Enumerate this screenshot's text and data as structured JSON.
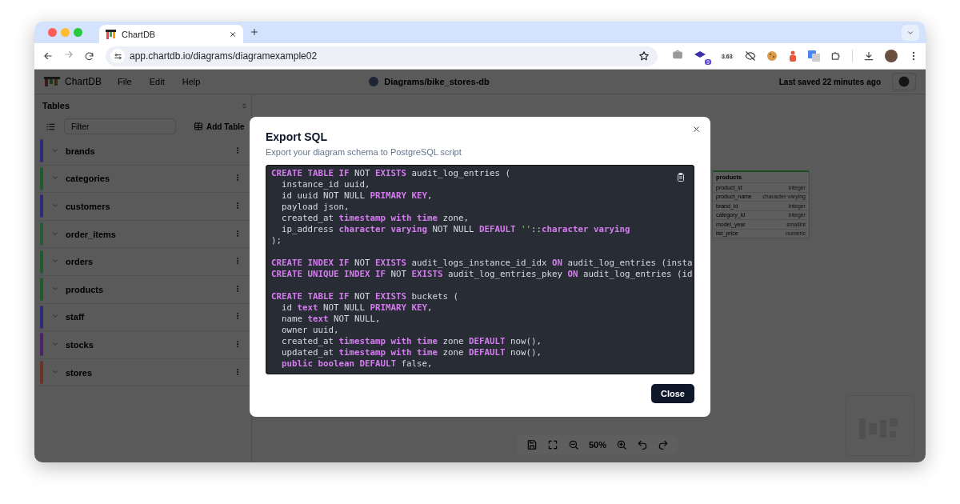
{
  "browser": {
    "tab_title": "ChartDB",
    "url": "app.chartdb.io/diagrams/diagramexample02",
    "extension_count": "9",
    "extension_reading": "3.63"
  },
  "app_header": {
    "logo": "ChartDB",
    "menu": [
      "File",
      "Edit",
      "Help"
    ],
    "diagram_path": "Diagrams/bike_stores-db",
    "last_saved": "Last saved 22 minutes ago"
  },
  "sidebar": {
    "title": "Tables",
    "filter_placeholder": "Filter",
    "add_button": "Add Table",
    "tables": [
      {
        "name": "brands",
        "color": "#2e2a78"
      },
      {
        "name": "categories",
        "color": "#1f5a2c"
      },
      {
        "name": "customers",
        "color": "#2e2a78"
      },
      {
        "name": "order_items",
        "color": "#2a5a34"
      },
      {
        "name": "orders",
        "color": "#1f5a2c"
      },
      {
        "name": "products",
        "color": "#1f5a2c"
      },
      {
        "name": "staff",
        "color": "#2e2a78"
      },
      {
        "name": "stocks",
        "color": "#4a2466"
      },
      {
        "name": "stores",
        "color": "#6a3322"
      }
    ]
  },
  "canvas": {
    "node": {
      "title": "products",
      "fields": [
        {
          "name": "product_id",
          "type": "integer"
        },
        {
          "name": "product_name",
          "type": "character varying"
        },
        {
          "name": "brand_id",
          "type": "integer"
        },
        {
          "name": "category_id",
          "type": "integer"
        },
        {
          "name": "model_year",
          "type": "smallint"
        },
        {
          "name": "list_price",
          "type": "numeric"
        }
      ]
    },
    "zoom": "50%"
  },
  "dialog": {
    "title": "Export SQL",
    "description": "Export your diagram schema to PostgreSQL script",
    "close_button": "Close",
    "code_blocks": [
      [
        [
          {
            "text": "CREATE TABLE IF",
            "kind": "keyword"
          },
          {
            "text": " NOT ",
            "kind": "plain"
          },
          {
            "text": "EXISTS",
            "kind": "keyword"
          },
          {
            "text": " audit_log_entries (",
            "kind": "plain"
          }
        ],
        [
          {
            "text": "  instance_id uuid,",
            "kind": "plain"
          }
        ],
        [
          {
            "text": "  id uuid NOT NULL ",
            "kind": "plain"
          },
          {
            "text": "PRIMARY KEY",
            "kind": "keyword"
          },
          {
            "text": ",",
            "kind": "plain"
          }
        ],
        [
          {
            "text": "  payload json,",
            "kind": "plain"
          }
        ],
        [
          {
            "text": "  created_at ",
            "kind": "plain"
          },
          {
            "text": "timestamp with time",
            "kind": "keyword"
          },
          {
            "text": " zone,",
            "kind": "plain"
          }
        ],
        [
          {
            "text": "  ip_address ",
            "kind": "plain"
          },
          {
            "text": "character varying",
            "kind": "keyword"
          },
          {
            "text": " NOT NULL ",
            "kind": "plain"
          },
          {
            "text": "DEFAULT",
            "kind": "keyword"
          },
          {
            "text": " ''",
            "kind": "string"
          },
          {
            "text": "::",
            "kind": "plain"
          },
          {
            "text": "character varying",
            "kind": "keyword"
          }
        ],
        [
          {
            "text": ");",
            "kind": "plain"
          }
        ]
      ],
      [
        [
          {
            "text": "CREATE INDEX IF",
            "kind": "keyword"
          },
          {
            "text": " NOT ",
            "kind": "plain"
          },
          {
            "text": "EXISTS",
            "kind": "keyword"
          },
          {
            "text": " audit_logs_instance_id_idx ",
            "kind": "plain"
          },
          {
            "text": "ON",
            "kind": "keyword"
          },
          {
            "text": " audit_log_entries (insta",
            "kind": "plain"
          }
        ],
        [
          {
            "text": "CREATE UNIQUE INDEX IF",
            "kind": "keyword"
          },
          {
            "text": " NOT ",
            "kind": "plain"
          },
          {
            "text": "EXISTS",
            "kind": "keyword"
          },
          {
            "text": " audit_log_entries_pkey ",
            "kind": "plain"
          },
          {
            "text": "ON",
            "kind": "keyword"
          },
          {
            "text": " audit_log_entries (id",
            "kind": "plain"
          }
        ]
      ],
      [
        [
          {
            "text": "CREATE TABLE IF",
            "kind": "keyword"
          },
          {
            "text": " NOT ",
            "kind": "plain"
          },
          {
            "text": "EXISTS",
            "kind": "keyword"
          },
          {
            "text": " buckets (",
            "kind": "plain"
          }
        ],
        [
          {
            "text": "  id ",
            "kind": "plain"
          },
          {
            "text": "text",
            "kind": "keyword"
          },
          {
            "text": " NOT NULL ",
            "kind": "plain"
          },
          {
            "text": "PRIMARY KEY",
            "kind": "keyword"
          },
          {
            "text": ",",
            "kind": "plain"
          }
        ],
        [
          {
            "text": "  name ",
            "kind": "plain"
          },
          {
            "text": "text",
            "kind": "keyword"
          },
          {
            "text": " NOT NULL,",
            "kind": "plain"
          }
        ],
        [
          {
            "text": "  owner uuid,",
            "kind": "plain"
          }
        ],
        [
          {
            "text": "  created_at ",
            "kind": "plain"
          },
          {
            "text": "timestamp with time",
            "kind": "keyword"
          },
          {
            "text": " zone ",
            "kind": "plain"
          },
          {
            "text": "DEFAULT",
            "kind": "keyword"
          },
          {
            "text": " now(),",
            "kind": "plain"
          }
        ],
        [
          {
            "text": "  updated_at ",
            "kind": "plain"
          },
          {
            "text": "timestamp with time",
            "kind": "keyword"
          },
          {
            "text": " zone ",
            "kind": "plain"
          },
          {
            "text": "DEFAULT",
            "kind": "keyword"
          },
          {
            "text": " now(),",
            "kind": "plain"
          }
        ],
        [
          {
            "text": "  public boolean DEFAULT",
            "kind": "keyword"
          },
          {
            "text": " false,",
            "kind": "plain"
          }
        ]
      ]
    ]
  }
}
